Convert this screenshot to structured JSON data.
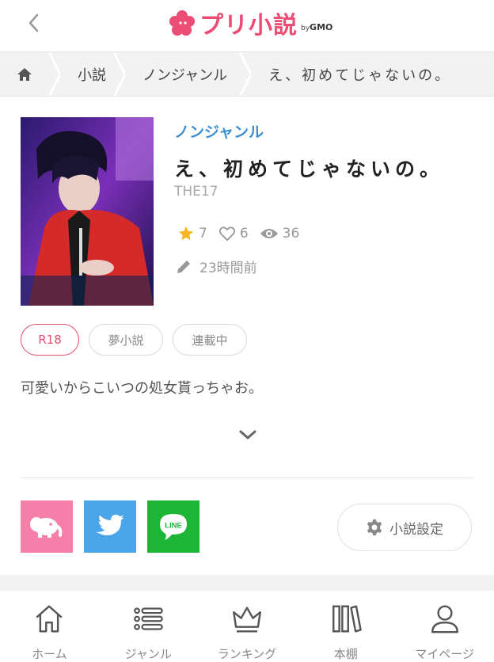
{
  "header": {
    "logo_text": "プリ小説",
    "logo_by": "by",
    "logo_company": "GMO"
  },
  "breadcrumb": {
    "items": [
      "小説",
      "ノンジャンル",
      "え、初めてじゃないの。"
    ]
  },
  "novel": {
    "genre": "ノンジャンル",
    "title": "え、初めてじゃないの。",
    "author": "THE17",
    "stars": "7",
    "likes": "6",
    "views": "36",
    "updated": "23時間前",
    "tags": [
      "R18",
      "夢小説",
      "連載中"
    ],
    "synopsis": "可愛いからこいつの処女貰っちゃお。"
  },
  "actions": {
    "settings_label": "小説設定"
  },
  "bottom_nav": {
    "items": [
      {
        "label": "ホーム",
        "icon": "home-icon"
      },
      {
        "label": "ジャンル",
        "icon": "list-icon"
      },
      {
        "label": "ランキング",
        "icon": "crown-icon"
      },
      {
        "label": "本棚",
        "icon": "bookshelf-icon"
      },
      {
        "label": "マイページ",
        "icon": "user-icon"
      }
    ]
  },
  "colors": {
    "brand_pink": "#ec4d74",
    "genre_blue": "#3e8ed0",
    "star": "#f5b623",
    "r18_tag": "#e2506e",
    "twitter": "#4aa6e8",
    "line": "#1cb535"
  }
}
